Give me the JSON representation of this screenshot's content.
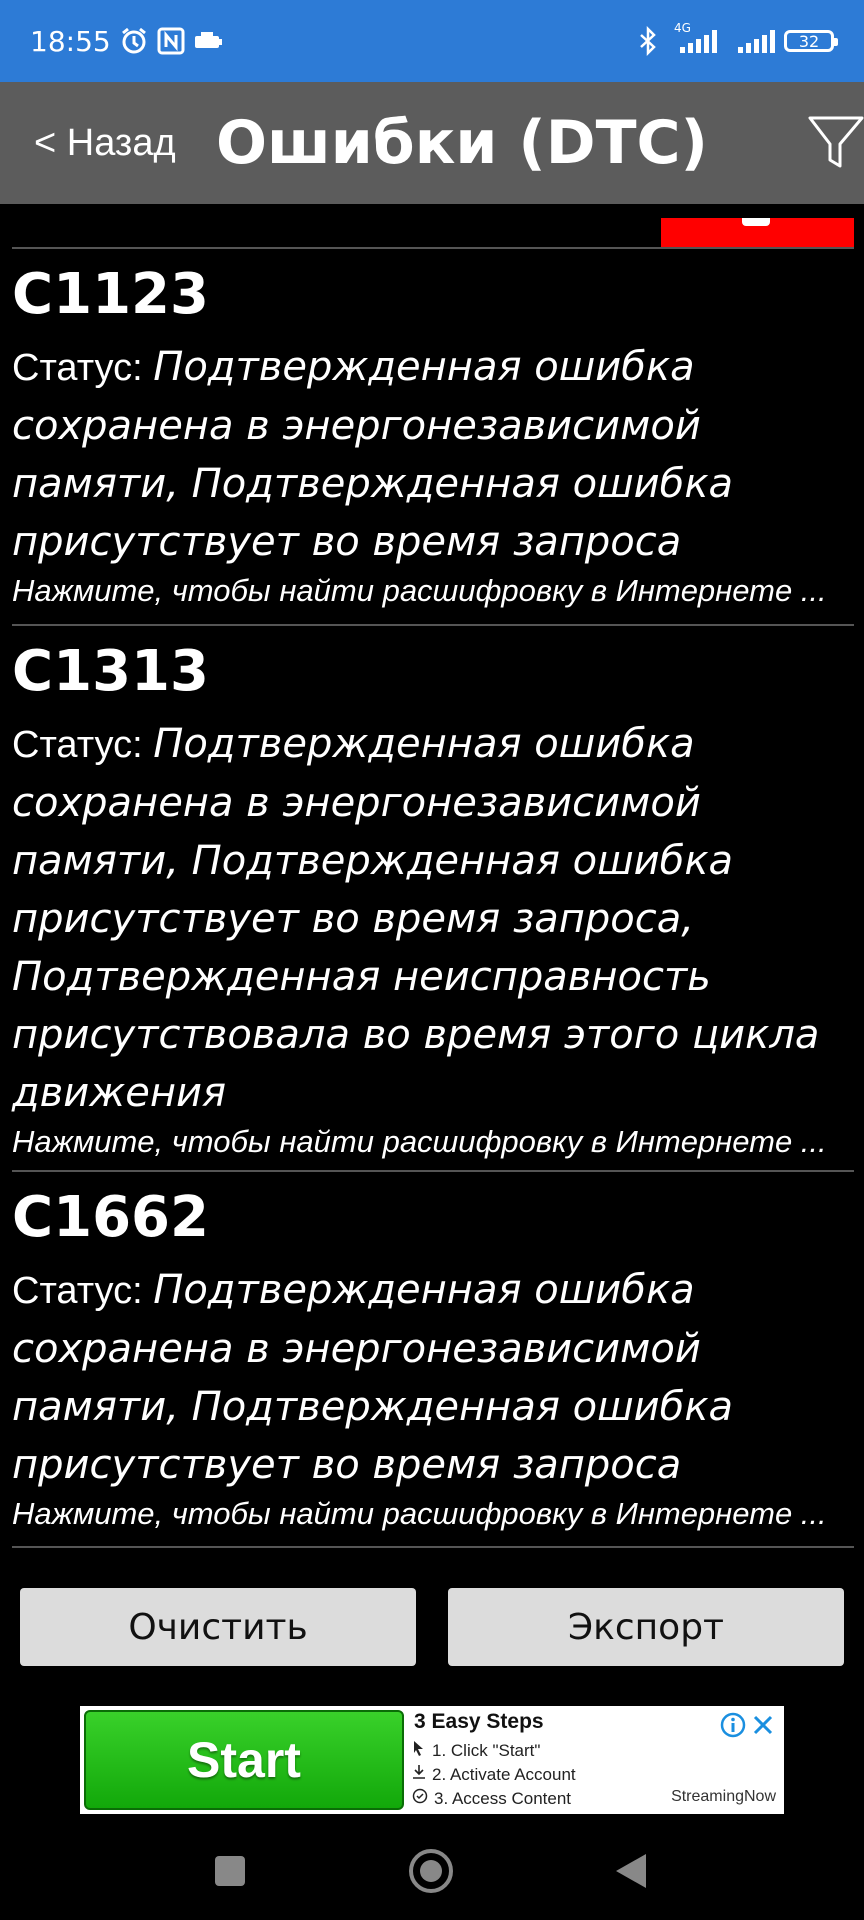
{
  "status_bar": {
    "time": "18:55",
    "battery": "32",
    "network": "4G",
    "icons": [
      "alarm-icon",
      "nfc-icon",
      "car-icon",
      "bluetooth-icon",
      "signal-icon",
      "signal-icon-2",
      "battery-icon"
    ]
  },
  "header": {
    "back_label": "< Назад",
    "title": "Ошибки (DTC)",
    "filter_icon": "filter-icon"
  },
  "errors": [
    {
      "code": "C1123",
      "status_label": "Статус: ",
      "status_text": "Подтвержденная ошибка сохранена в энергонезависимой памяти, Подтвержденная ошибка присутствует во время запроса",
      "hint": "Нажмите, чтобы найти расшифровку в Интернете ..."
    },
    {
      "code": "C1313",
      "status_label": "Статус: ",
      "status_text": "Подтвержденная ошибка сохранена в энергонезависимой памяти, Подтвержденная ошибка присутствует во время запроса, Подтвержденная неисправность присутствовала во время этого цикла движения",
      "hint": "Нажмите, чтобы найти расшифровку в Интернете ..."
    },
    {
      "code": "C1662",
      "status_label": "Статус: ",
      "status_text": "Подтвержденная ошибка сохранена в энергонезависимой памяти, Подтвержденная ошибка присутствует во время запроса",
      "hint": "Нажмите, чтобы найти расшифровку в Интернете ..."
    }
  ],
  "actions": {
    "clear_label": "Очистить",
    "export_label": "Экспорт"
  },
  "ad": {
    "start_label": "Start",
    "title": "3 Easy Steps",
    "steps": [
      "1. Click \"Start\"",
      "2. Activate Account",
      "3. Access Content"
    ],
    "brand": "StreamingNow"
  },
  "colors": {
    "status_bar": "#2d7bd6",
    "header": "#5c5c5c",
    "background": "#000000",
    "accent_red": "#ff0000",
    "button": "#dcdcdc",
    "ad_green": "#1fbd12"
  }
}
